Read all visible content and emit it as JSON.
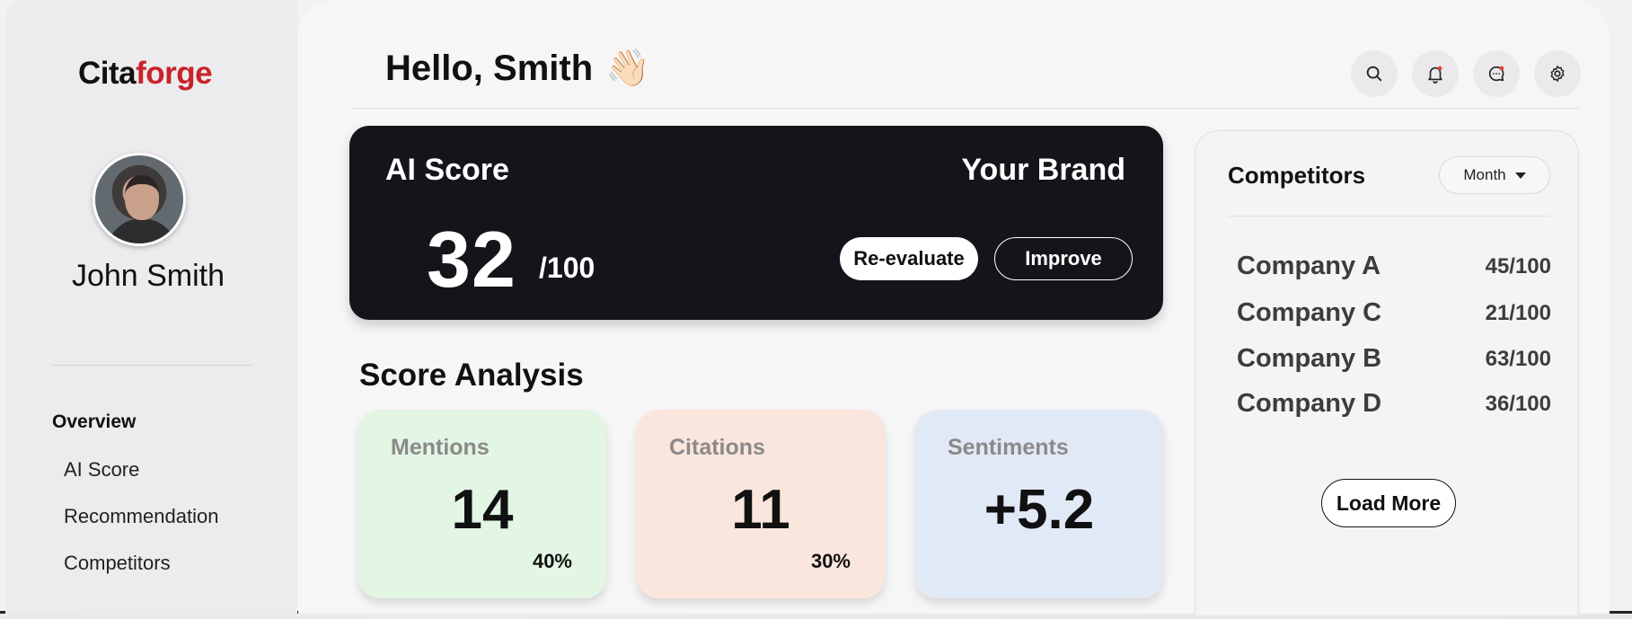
{
  "brand": {
    "logo_part1": "Cita",
    "logo_part2": "forge"
  },
  "user": {
    "name": "John Smith"
  },
  "sidebar": {
    "section": "Overview",
    "items": [
      {
        "label": "AI Score"
      },
      {
        "label": "Recommendation"
      },
      {
        "label": "Competitors"
      }
    ]
  },
  "header": {
    "greeting": "Hello, Smith",
    "wave_emoji": "👋🏻",
    "icons": [
      "search-icon",
      "bell-icon",
      "chat-icon",
      "gear-icon"
    ]
  },
  "score_card": {
    "title": "AI Score",
    "brand_label": "Your Brand",
    "score": "32",
    "max": "/100",
    "reevaluate_label": "Re-evaluate",
    "improve_label": "Improve"
  },
  "analysis": {
    "title": "Score Analysis",
    "cards": [
      {
        "label": "Mentions",
        "value": "14",
        "percent": "40%",
        "color": "#e3f5e3"
      },
      {
        "label": "Citations",
        "value": "11",
        "percent": "30%",
        "color": "#fbe6dd"
      },
      {
        "label": "Sentiments",
        "value": "+5.2",
        "percent": "",
        "color": "#e2e9f6"
      }
    ]
  },
  "competitors": {
    "title": "Competitors",
    "period": "Month",
    "rows": [
      {
        "name": "Company A",
        "score": "45/100"
      },
      {
        "name": "Company C",
        "score": "21/100"
      },
      {
        "name": "Company B",
        "score": "63/100"
      },
      {
        "name": "Company D",
        "score": "36/100"
      }
    ],
    "load_more_label": "Load More"
  },
  "colors": {
    "accent": "#c9232a",
    "dark_card": "#17131a"
  }
}
